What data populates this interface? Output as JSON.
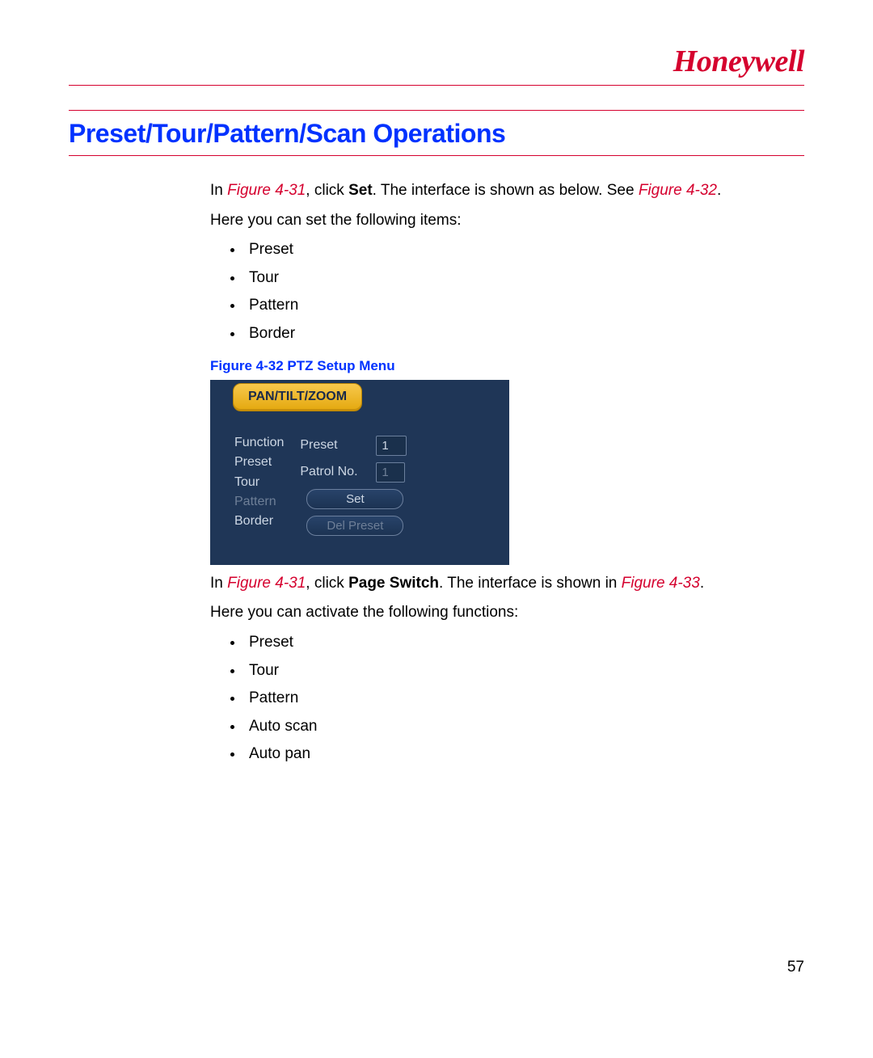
{
  "brand": "Honeywell",
  "section_title": "Preset/Tour/Pattern/Scan Operations",
  "para1": {
    "t1": "In ",
    "fig1": "Figure 4-31",
    "t2": ", click ",
    "b1": "Set",
    "t3": ". The interface is shown as below. See ",
    "fig2": "Figure 4-32",
    "t4": "."
  },
  "para2": "Here you can set the following items:",
  "list1": [
    "Preset",
    "Tour",
    "Pattern",
    "Border"
  ],
  "fig_caption": "Figure 4-32 PTZ Setup Menu",
  "ptz": {
    "tab": "PAN/TILT/ZOOM",
    "menu": {
      "function": "Function",
      "preset": "Preset",
      "tour": "Tour",
      "pattern": "Pattern",
      "border": "Border"
    },
    "form": {
      "preset_label": "Preset",
      "preset_value": "1",
      "patrol_label": "Patrol No.",
      "patrol_value": "1",
      "set_btn": "Set",
      "del_btn": "Del Preset"
    }
  },
  "para3": {
    "t1": "In ",
    "fig1": "Figure 4-31",
    "t2": ", click ",
    "b1": "Page Switch",
    "t3": ". The interface is shown in ",
    "fig2": "Figure 4-33",
    "t4": "."
  },
  "para4": "Here you can activate the following functions:",
  "list2": [
    "Preset",
    "Tour",
    "Pattern",
    "Auto scan",
    "Auto pan"
  ],
  "page_number": "57"
}
